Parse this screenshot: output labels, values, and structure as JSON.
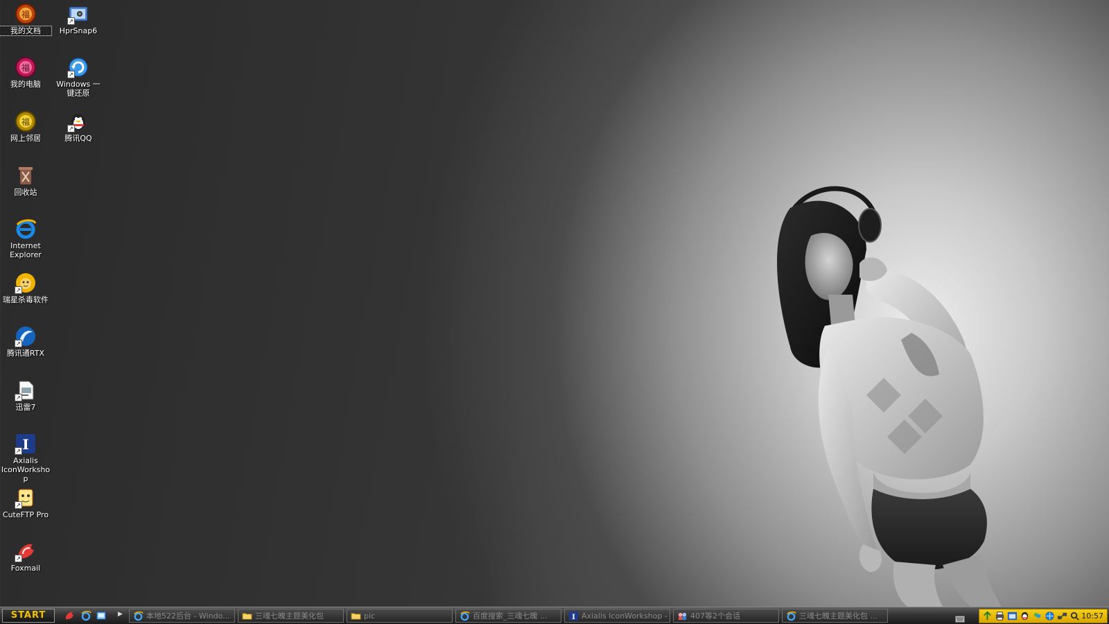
{
  "desktop": {
    "icons": [
      {
        "label": "我的文档"
      },
      {
        "label": "HprSnap6"
      },
      {
        "label": "我的电脑"
      },
      {
        "label": "Windows 一键还原"
      },
      {
        "label": "网上邻居"
      },
      {
        "label": "腾讯QQ"
      },
      {
        "label": "回收站"
      },
      {
        "label": "Internet Explorer"
      },
      {
        "label": "瑞星杀毒软件"
      },
      {
        "label": "腾讯通RTX"
      },
      {
        "label": "迅雷7"
      },
      {
        "label": "Axialis IconWorkshop"
      },
      {
        "label": "CuteFTP Pro"
      },
      {
        "label": "Foxmail"
      }
    ]
  },
  "taskbar": {
    "start_label": "START",
    "quick_launch": [
      {
        "icon": "foxmail-icon"
      },
      {
        "icon": "internet-explorer-icon"
      },
      {
        "icon": "show-desktop-icon"
      }
    ],
    "tasks": [
      {
        "label": "本地522后台 - Windo...",
        "icon": "internet-explorer-icon"
      },
      {
        "label": "三魂七魄主题美化包",
        "icon": "folder-icon"
      },
      {
        "label": "pic",
        "icon": "folder-icon"
      },
      {
        "label": "百度搜索_三魂七魄 ...",
        "icon": "internet-explorer-icon"
      },
      {
        "label": "Axialis IconWorkshop -",
        "icon": "axialis-icon"
      },
      {
        "label": "407等2个会话",
        "icon": "rtx-chat-icon"
      },
      {
        "label": "三魂七魄主题美化包 ...",
        "icon": "internet-explorer-icon"
      }
    ],
    "tray": {
      "clock": "10:57",
      "icons": [
        "network-icon",
        "printer-icon",
        "window-icon",
        "qq-icon",
        "messenger-icon",
        "globe-icon",
        "network-connection-icon",
        "search-icon"
      ]
    }
  },
  "colors": {
    "start_text": "#f2c200",
    "tray_background": "#e6b800",
    "taskbar": "#2a2a2a"
  }
}
